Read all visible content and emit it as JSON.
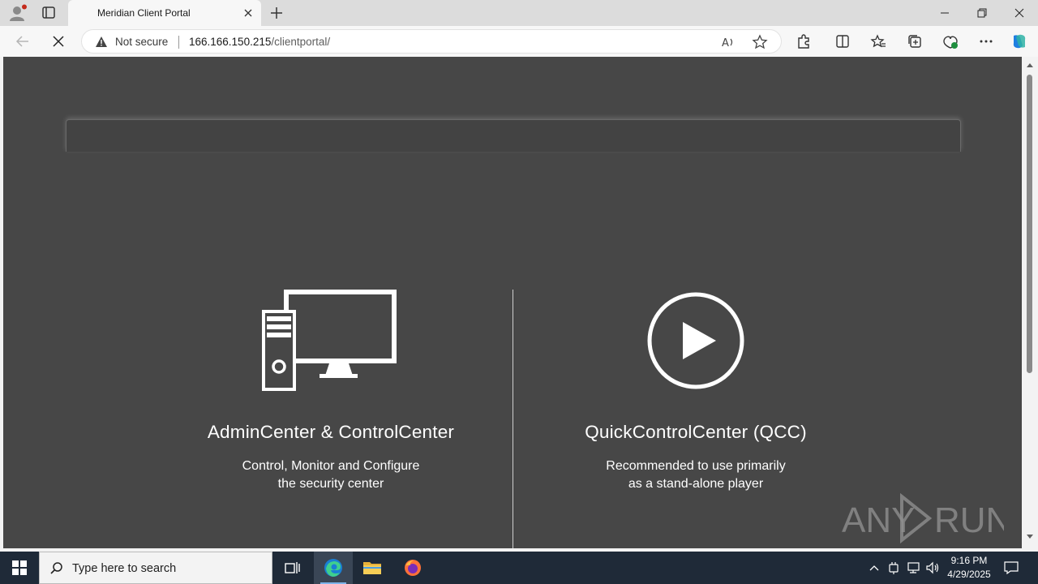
{
  "browser": {
    "tab_title": "Meridian Client Portal",
    "security_label": "Not secure",
    "url_host": "166.166.150.215",
    "url_path": "/clientportal/"
  },
  "page": {
    "options": [
      {
        "title": "AdminCenter & ControlCenter",
        "description_line1": "Control, Monitor and Configure",
        "description_line2": "the security center",
        "icon": "desktop-computer-icon"
      },
      {
        "title": "QuickControlCenter (QCC)",
        "description_line1": "Recommended to use primarily",
        "description_line2": "as a stand-alone player",
        "icon": "play-circle-icon"
      }
    ],
    "watermark": "ANY RUN"
  },
  "taskbar": {
    "search_placeholder": "Type here to search",
    "time": "9:16 PM",
    "date": "4/29/2025"
  },
  "colors": {
    "page_background": "#474747",
    "page_text": "#ffffff",
    "taskbar": "#1f2a38",
    "accent": "#0078d4"
  }
}
